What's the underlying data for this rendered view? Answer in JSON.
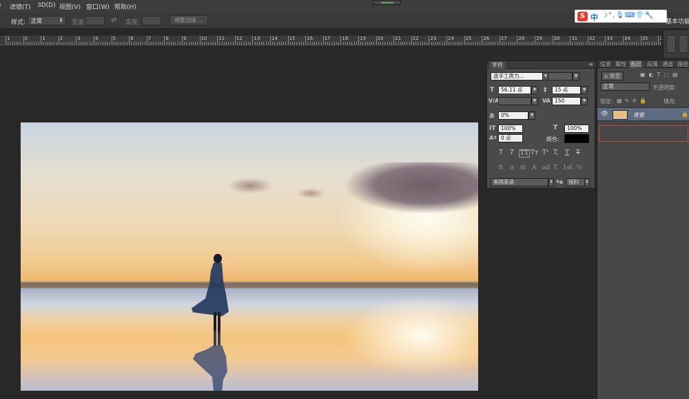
{
  "menu": {
    "items": [
      "滤镜(T)",
      "3D(D)",
      "视图(V)",
      "窗口(W)",
      "帮助(H)"
    ]
  },
  "options_bar": {
    "style_label": "样式:",
    "style_value": "正常",
    "width_label": "宽度:",
    "height_label": "高度:",
    "refine_edge": "调整边缘 ..."
  },
  "ime": {
    "logo": "S",
    "lang": "中",
    "icons": "☽°,🎙⌨👕🔧"
  },
  "workspace": {
    "label": "基本功能"
  },
  "ruler": {
    "labels": [
      "1",
      "0",
      "1",
      "2",
      "3",
      "4",
      "5",
      "6",
      "7",
      "8",
      "9",
      "10",
      "11",
      "12",
      "13",
      "14",
      "15",
      "16",
      "17",
      "18",
      "19",
      "20",
      "21",
      "22",
      "23",
      "24",
      "25",
      "26",
      "27",
      "28",
      "29",
      "30",
      "31",
      "32",
      "33",
      "34",
      "35",
      "36"
    ]
  },
  "character_panel": {
    "tab": "字符",
    "font_family": "造字工房力...",
    "font_style": "-",
    "font_size": "56.11 点",
    "leading": "15 点",
    "kerning": "",
    "tracking": "150",
    "scale_percent": "0%",
    "vertical_scale": "100%",
    "horizontal_scale": "100%",
    "baseline_shift": "0 点",
    "color_label": "颜色:",
    "color": "#000000",
    "type_style_buttons": [
      "T",
      "T",
      "TT",
      "Tт",
      "T¹",
      "T,",
      "T",
      "T"
    ],
    "opentype_buttons": [
      "fi",
      "ơ",
      "st",
      "A",
      "ad",
      "T",
      "1st",
      "½"
    ],
    "language": "美国英语",
    "aa_icon": "ªa",
    "antialias": "锐利"
  },
  "layers_panel": {
    "tabs": [
      "信息",
      "属性",
      "图层",
      "段落",
      "通道",
      "路径"
    ],
    "active_tab": "图层",
    "filter_label": "ρ 类型",
    "blend_mode": "正常",
    "opacity_label": "不透明度:",
    "lock_label": "锁定:",
    "fill_label": "填充:",
    "layers": [
      {
        "name": "背景",
        "locked": true,
        "visible": true
      }
    ]
  }
}
